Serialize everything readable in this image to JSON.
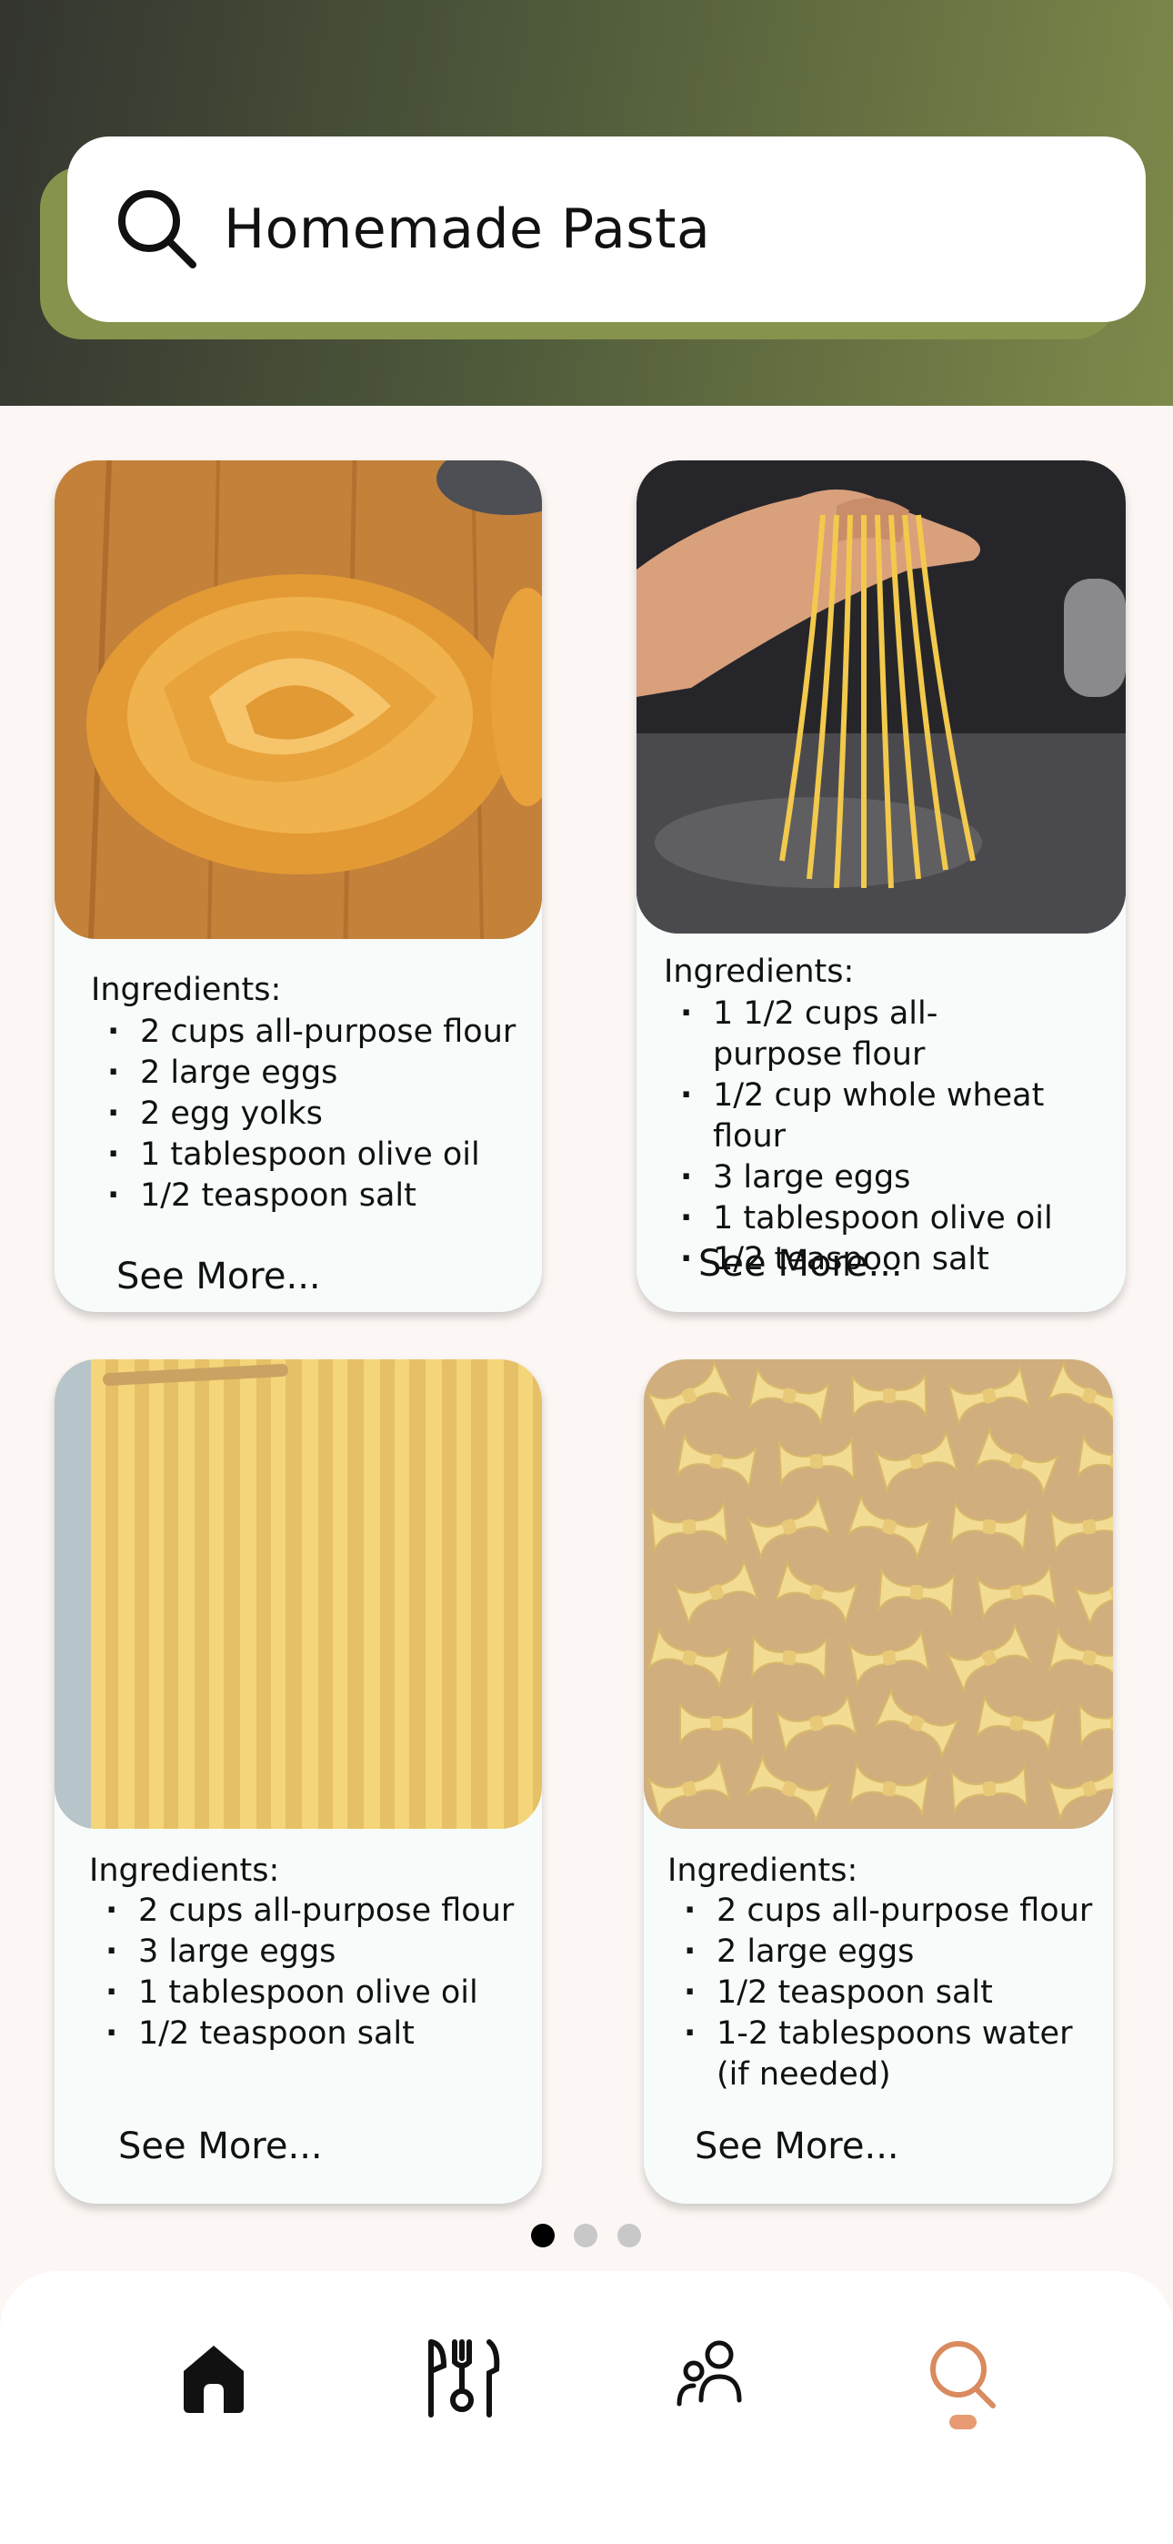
{
  "search": {
    "query": "Homemade Pasta"
  },
  "colors": {
    "accent": "#d98a5e",
    "header_dark": "#33352f",
    "header_olive": "#7e8a4a"
  },
  "cards": [
    {
      "image": "tagliatelle-nest-photo",
      "title": "Ingredients:",
      "ingredients": [
        "2 cups all-purpose flour",
        "2 large eggs",
        "2 egg yolks",
        "1 tablespoon olive oil",
        "1/2 teaspoon salt"
      ],
      "see_more": "See More..."
    },
    {
      "image": "spaghetti-in-hand-photo",
      "title": "Ingredients:",
      "ingredients": [
        "1 1/2 cups all-purpose flour",
        "1/2 cup whole wheat flour",
        "3 large eggs",
        "1 tablespoon olive oil",
        "1/2 teaspoon salt"
      ],
      "see_more": "See More..."
    },
    {
      "image": "hanging-fettuccine-photo",
      "title": "Ingredients:",
      "ingredients": [
        "2 cups all-purpose flour",
        "3 large eggs",
        "1 tablespoon olive oil",
        "1/2 teaspoon salt"
      ],
      "see_more": "See More..."
    },
    {
      "image": "farfalle-on-board-photo",
      "title": "Ingredients:",
      "ingredients": [
        "2 cups all-purpose flour",
        "2 large eggs",
        "1/2 teaspoon salt",
        "1-2 tablespoons water (if needed)"
      ],
      "see_more": "See More..."
    }
  ],
  "pagination": {
    "total": 3,
    "active": 1
  },
  "nav": [
    {
      "name": "home",
      "icon": "home-icon"
    },
    {
      "name": "recipes",
      "icon": "utensils-icon"
    },
    {
      "name": "community",
      "icon": "people-icon"
    },
    {
      "name": "search",
      "icon": "search-icon",
      "active": true
    }
  ]
}
